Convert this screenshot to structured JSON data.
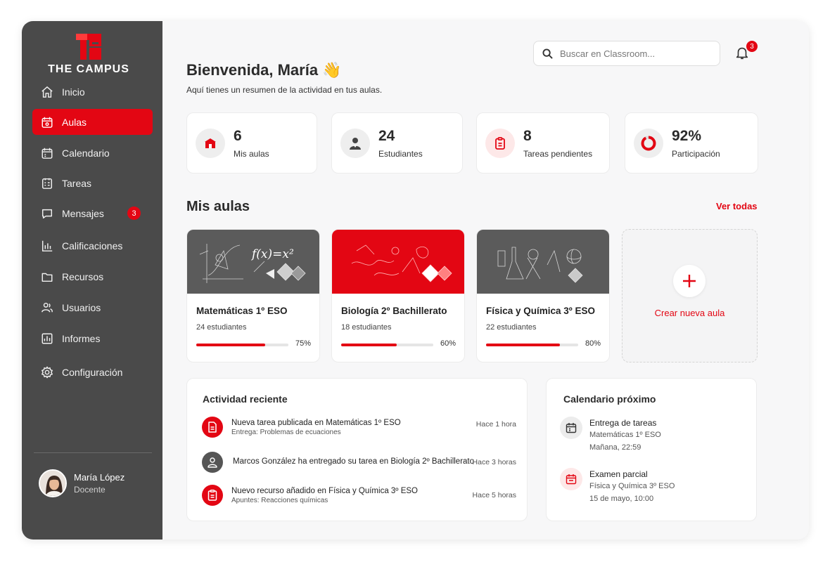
{
  "brand": {
    "name": "THE CAMPUS",
    "accent": "#e30613",
    "sidebar_bg": "#4a4a4a"
  },
  "sidebar": {
    "items": [
      {
        "label": "Inicio",
        "icon": "home-icon",
        "active": false
      },
      {
        "label": "Aulas",
        "icon": "calendar-icon",
        "active": true
      },
      {
        "label": "Calendario",
        "icon": "calendar-icon",
        "active": false
      },
      {
        "label": "Tareas",
        "icon": "task-list-icon",
        "active": false
      },
      {
        "label": "Mensajes",
        "icon": "chat-icon",
        "active": false,
        "badge": "3"
      },
      {
        "label": "Calificaciones",
        "icon": "bar-chart-icon",
        "active": false
      },
      {
        "label": "Recursos",
        "icon": "folder-icon",
        "active": false
      },
      {
        "label": "Usuarios",
        "icon": "users-icon",
        "active": false
      },
      {
        "label": "Informes",
        "icon": "report-icon",
        "active": false
      },
      {
        "label": "Configuración",
        "icon": "gear-icon",
        "active": false
      }
    ],
    "user": {
      "name": "María López",
      "role": "Docente"
    }
  },
  "header": {
    "search_placeholder": "Buscar en Classroom...",
    "notifications_count": "3",
    "greeting": "Bienvenida, María 👋",
    "subtitle": "Aquí tienes un resumen de la actividad en tus aulas."
  },
  "stats": [
    {
      "value": "6",
      "label": "Mis aulas",
      "icon": "classroom-icon"
    },
    {
      "value": "24",
      "label": "Estudiantes",
      "icon": "student-icon"
    },
    {
      "value": "8",
      "label": "Tareas pendientes",
      "icon": "clipboard-icon"
    },
    {
      "value": "92%",
      "label": "Participación",
      "icon": "donut-icon",
      "fraction": 0.92
    }
  ],
  "classes_section": {
    "title": "Mis aulas",
    "see_all": "Ver todas",
    "courses": [
      {
        "name": "Matemáticas 1º ESO",
        "students": "24 estudiantes",
        "progress_label": "75%",
        "progress": 0.75,
        "banner": "gray",
        "banner_formula": "f(x)=x²"
      },
      {
        "name": "Biología 2º Bachillerato",
        "students": "18 estudiantes",
        "progress_label": "60%",
        "progress": 0.6,
        "banner": "red"
      },
      {
        "name": "Física y Química 3º ESO",
        "students": "22 estudiantes",
        "progress_label": "80%",
        "progress": 0.8,
        "banner": "gray"
      }
    ],
    "create_label": "Crear nueva aula"
  },
  "activity": {
    "title": "Actividad reciente",
    "items": [
      {
        "text": "Nueva tarea publicada en Matemáticas 1º ESO",
        "detail": "Entrega: Problemas de ecuaciones",
        "time": "Hace 1 hora",
        "icon": "document-icon"
      },
      {
        "text": "Marcos González ha entregado su tarea en Biología 2º Bachillerato",
        "detail": "",
        "time": "Hace 3 horas",
        "icon": "user-icon"
      },
      {
        "text": "Nuevo recurso añadido en Física y Química 3º ESO",
        "detail": "Apuntes: Reacciones químicas",
        "time": "Hace 5 horas",
        "icon": "clipboard-icon"
      }
    ]
  },
  "calendar": {
    "title": "Calendario próximo",
    "events": [
      {
        "title": "Entrega de tareas",
        "course": "Matemáticas 1º ESO",
        "when": "Mañana, 22:59"
      },
      {
        "title": "Examen parcial",
        "course": "Física y Química 3º ESO",
        "when": "15 de mayo, 10:00"
      }
    ]
  }
}
